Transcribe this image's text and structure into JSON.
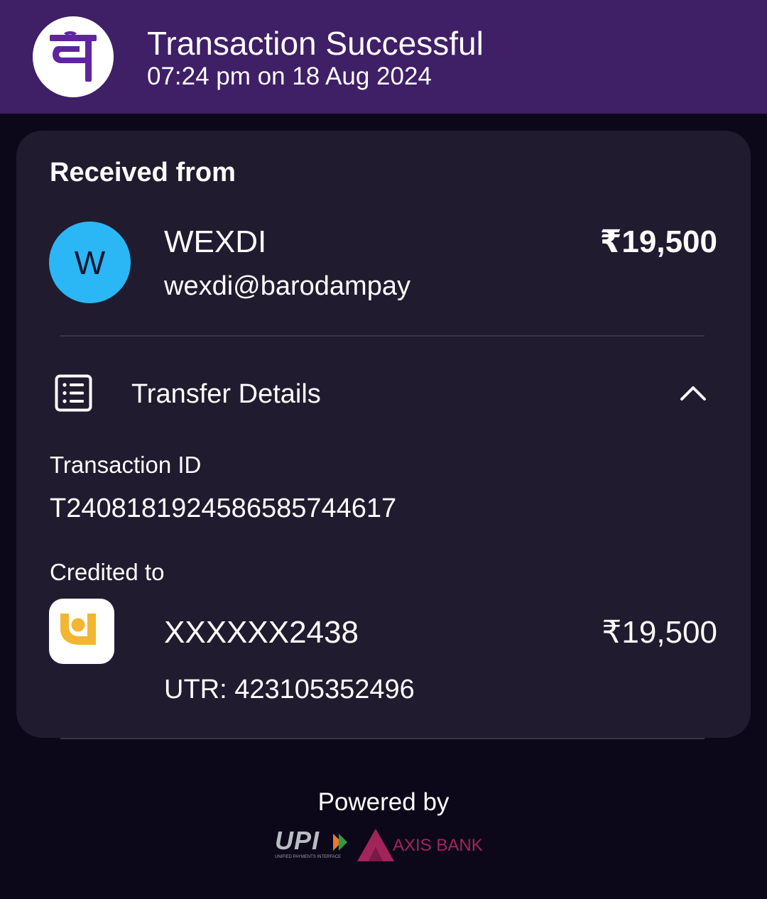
{
  "header": {
    "logo_glyph": "पे",
    "title": "Transaction Successful",
    "timestamp": "07:24 pm on 18 Aug 2024",
    "background_color": "#3f1f66",
    "logo_color": "#5f259f"
  },
  "received": {
    "heading": "Received from",
    "avatar_letter": "W",
    "avatar_color": "#2bb7f5",
    "name": "WEXDI",
    "upi_id": "wexdi@barodampay",
    "amount": "₹19,500"
  },
  "transfer_details": {
    "title": "Transfer Details",
    "icon": "list-document-icon",
    "toggle_icon": "chevron-up-icon",
    "expanded": true,
    "transaction_id_label": "Transaction ID",
    "transaction_id": "T2408181924586585744617",
    "credited_to_label": "Credited to",
    "bank_icon": "pnb-bank-icon",
    "account_number": "XXXXXX2438",
    "amount": "₹19,500",
    "utr": "UTR: 423105352496"
  },
  "footer": {
    "powered_by": "Powered by",
    "upi_logo_text": "UPI",
    "upi_logo_subtext": "UNIFIED PAYMENTS INTERFACE",
    "bank_logo_text": "AXIS BANK",
    "bank_brand_color": "#a3245a"
  }
}
